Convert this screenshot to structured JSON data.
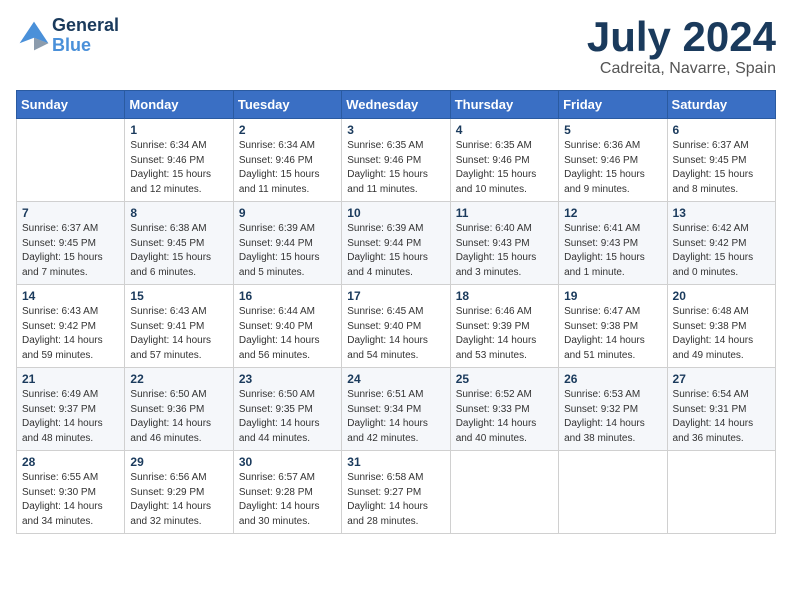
{
  "header": {
    "logo_general": "General",
    "logo_blue": "Blue",
    "month_title": "July 2024",
    "location": "Cadreita, Navarre, Spain"
  },
  "days_of_week": [
    "Sunday",
    "Monday",
    "Tuesday",
    "Wednesday",
    "Thursday",
    "Friday",
    "Saturday"
  ],
  "weeks": [
    [
      {
        "day": "",
        "info": ""
      },
      {
        "day": "1",
        "info": "Sunrise: 6:34 AM\nSunset: 9:46 PM\nDaylight: 15 hours\nand 12 minutes."
      },
      {
        "day": "2",
        "info": "Sunrise: 6:34 AM\nSunset: 9:46 PM\nDaylight: 15 hours\nand 11 minutes."
      },
      {
        "day": "3",
        "info": "Sunrise: 6:35 AM\nSunset: 9:46 PM\nDaylight: 15 hours\nand 11 minutes."
      },
      {
        "day": "4",
        "info": "Sunrise: 6:35 AM\nSunset: 9:46 PM\nDaylight: 15 hours\nand 10 minutes."
      },
      {
        "day": "5",
        "info": "Sunrise: 6:36 AM\nSunset: 9:46 PM\nDaylight: 15 hours\nand 9 minutes."
      },
      {
        "day": "6",
        "info": "Sunrise: 6:37 AM\nSunset: 9:45 PM\nDaylight: 15 hours\nand 8 minutes."
      }
    ],
    [
      {
        "day": "7",
        "info": "Sunrise: 6:37 AM\nSunset: 9:45 PM\nDaylight: 15 hours\nand 7 minutes."
      },
      {
        "day": "8",
        "info": "Sunrise: 6:38 AM\nSunset: 9:45 PM\nDaylight: 15 hours\nand 6 minutes."
      },
      {
        "day": "9",
        "info": "Sunrise: 6:39 AM\nSunset: 9:44 PM\nDaylight: 15 hours\nand 5 minutes."
      },
      {
        "day": "10",
        "info": "Sunrise: 6:39 AM\nSunset: 9:44 PM\nDaylight: 15 hours\nand 4 minutes."
      },
      {
        "day": "11",
        "info": "Sunrise: 6:40 AM\nSunset: 9:43 PM\nDaylight: 15 hours\nand 3 minutes."
      },
      {
        "day": "12",
        "info": "Sunrise: 6:41 AM\nSunset: 9:43 PM\nDaylight: 15 hours\nand 1 minute."
      },
      {
        "day": "13",
        "info": "Sunrise: 6:42 AM\nSunset: 9:42 PM\nDaylight: 15 hours\nand 0 minutes."
      }
    ],
    [
      {
        "day": "14",
        "info": "Sunrise: 6:43 AM\nSunset: 9:42 PM\nDaylight: 14 hours\nand 59 minutes."
      },
      {
        "day": "15",
        "info": "Sunrise: 6:43 AM\nSunset: 9:41 PM\nDaylight: 14 hours\nand 57 minutes."
      },
      {
        "day": "16",
        "info": "Sunrise: 6:44 AM\nSunset: 9:40 PM\nDaylight: 14 hours\nand 56 minutes."
      },
      {
        "day": "17",
        "info": "Sunrise: 6:45 AM\nSunset: 9:40 PM\nDaylight: 14 hours\nand 54 minutes."
      },
      {
        "day": "18",
        "info": "Sunrise: 6:46 AM\nSunset: 9:39 PM\nDaylight: 14 hours\nand 53 minutes."
      },
      {
        "day": "19",
        "info": "Sunrise: 6:47 AM\nSunset: 9:38 PM\nDaylight: 14 hours\nand 51 minutes."
      },
      {
        "day": "20",
        "info": "Sunrise: 6:48 AM\nSunset: 9:38 PM\nDaylight: 14 hours\nand 49 minutes."
      }
    ],
    [
      {
        "day": "21",
        "info": "Sunrise: 6:49 AM\nSunset: 9:37 PM\nDaylight: 14 hours\nand 48 minutes."
      },
      {
        "day": "22",
        "info": "Sunrise: 6:50 AM\nSunset: 9:36 PM\nDaylight: 14 hours\nand 46 minutes."
      },
      {
        "day": "23",
        "info": "Sunrise: 6:50 AM\nSunset: 9:35 PM\nDaylight: 14 hours\nand 44 minutes."
      },
      {
        "day": "24",
        "info": "Sunrise: 6:51 AM\nSunset: 9:34 PM\nDaylight: 14 hours\nand 42 minutes."
      },
      {
        "day": "25",
        "info": "Sunrise: 6:52 AM\nSunset: 9:33 PM\nDaylight: 14 hours\nand 40 minutes."
      },
      {
        "day": "26",
        "info": "Sunrise: 6:53 AM\nSunset: 9:32 PM\nDaylight: 14 hours\nand 38 minutes."
      },
      {
        "day": "27",
        "info": "Sunrise: 6:54 AM\nSunset: 9:31 PM\nDaylight: 14 hours\nand 36 minutes."
      }
    ],
    [
      {
        "day": "28",
        "info": "Sunrise: 6:55 AM\nSunset: 9:30 PM\nDaylight: 14 hours\nand 34 minutes."
      },
      {
        "day": "29",
        "info": "Sunrise: 6:56 AM\nSunset: 9:29 PM\nDaylight: 14 hours\nand 32 minutes."
      },
      {
        "day": "30",
        "info": "Sunrise: 6:57 AM\nSunset: 9:28 PM\nDaylight: 14 hours\nand 30 minutes."
      },
      {
        "day": "31",
        "info": "Sunrise: 6:58 AM\nSunset: 9:27 PM\nDaylight: 14 hours\nand 28 minutes."
      },
      {
        "day": "",
        "info": ""
      },
      {
        "day": "",
        "info": ""
      },
      {
        "day": "",
        "info": ""
      }
    ]
  ]
}
